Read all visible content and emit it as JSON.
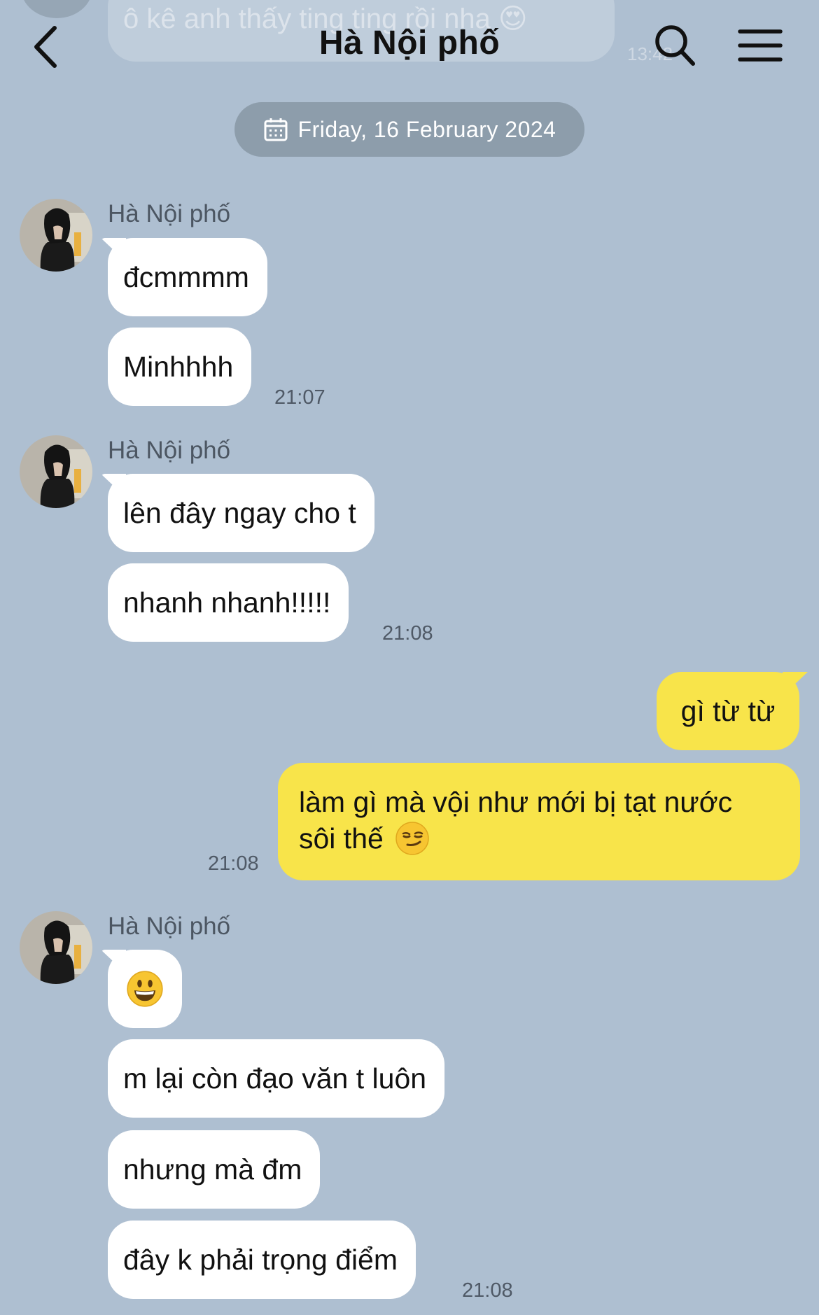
{
  "header": {
    "title": "Hà Nội phố"
  },
  "previous_message": {
    "text": "ô kê anh thấy ting ting rồi nha 😍",
    "time": "13:42"
  },
  "date_separator": "Friday, 16 February 2024",
  "colors": {
    "background": "#aebfd1",
    "incoming_bubble": "#ffffff",
    "outgoing_bubble": "#f8e44a",
    "date_pill": "#8d9dab"
  },
  "icons": {
    "back": "back-chevron-icon",
    "search": "search-icon",
    "menu": "menu-icon",
    "calendar": "calendar-icon"
  },
  "groups": [
    {
      "sender": "Hà Nội phố",
      "messages": [
        "đcmmmm",
        "Minhhhh"
      ],
      "time": "21:07"
    },
    {
      "sender": "Hà Nội phố",
      "messages": [
        "lên đây ngay cho t",
        "nhanh nhanh!!!!!"
      ],
      "time": "21:08"
    },
    {
      "sender": "me",
      "messages": [
        "gì từ từ",
        "làm gì mà vội như mới bị tạt nước",
        "sôi thế"
      ],
      "time": "21:08"
    },
    {
      "sender": "Hà Nội phố",
      "messages": [
        "😀",
        "m lại còn đạo văn t luôn",
        "nhưng mà đm",
        "đây k phải trọng điểm"
      ],
      "time": "21:08"
    }
  ]
}
